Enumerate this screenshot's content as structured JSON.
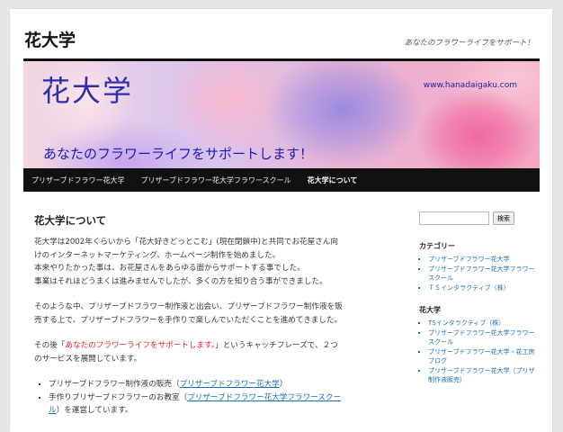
{
  "site": {
    "title": "花大学",
    "description": "あなたのフラワーライフをサポート！"
  },
  "banner": {
    "title": "花大学",
    "url": "www.hanadaigaku.com",
    "tagline": "あなたのフラワーライフをサポートします！"
  },
  "nav": {
    "items": [
      {
        "label": "プリザーブドフラワー花大学"
      },
      {
        "label": "プリザーブドフラワー花大学フラワースクール"
      },
      {
        "label": "花大学について"
      }
    ]
  },
  "article": {
    "heading": "花大学について",
    "p1": [
      "花大学は2002年くらいから「花大好きどっとこむ」(現在閉鎖中)と共同でお花屋さん向",
      "けのインターネットマーケティング、ホームページ制作を始めました。",
      "本来やりたかった事は、お花屋さんをあらゆる面からサポートする事でした。",
      "事業はそれほどうまくは進みませんでしたが、多くの方を知り合う事ができました。"
    ],
    "p2": [
      "そのような中、プリザーブドフラワー制作液と出会い、プリザーブドフラワー制作液を販",
      "売する上で、プリザーブドフラワーを手作りで楽しんでいただくことを進めてきました。"
    ],
    "p3_prefix": "その後「",
    "p3_highlight": "あなたのフラワーライフをサポートします。",
    "p3_suffix": "」というキャッチフレーズで、２つ",
    "p3_line2": "のサービスを展開しています。",
    "list": [
      {
        "prefix": "プリザーブドフラワー制作液の販売（",
        "link": "プリザーブドフラワー花大学",
        "suffix": "）"
      },
      {
        "prefix": "手作りプリザーブドフラワーのお教室（",
        "link": "プリザーブドフラワー花大学フラワースクー",
        "link2": "ル",
        "suffix": "）を運営しています。"
      }
    ]
  },
  "sidebar": {
    "search_button": "検索",
    "search_placeholder": "",
    "categories_title": "カテゴリー",
    "categories": [
      "プリザーブドフラワー花大学",
      "プリザーブドフラワー花大学フラワースクール",
      "ＴＳインタラクティブ（株）"
    ],
    "links_title": "花大学",
    "links": [
      "TSインタラクティブ（株）",
      "プリザーブドフラワー花大学フラワースクール",
      "プリザーブドフラワー花大学・花工房ブログ",
      "プリザーブドフラワー花大学（プリザ制作液販売）"
    ]
  }
}
